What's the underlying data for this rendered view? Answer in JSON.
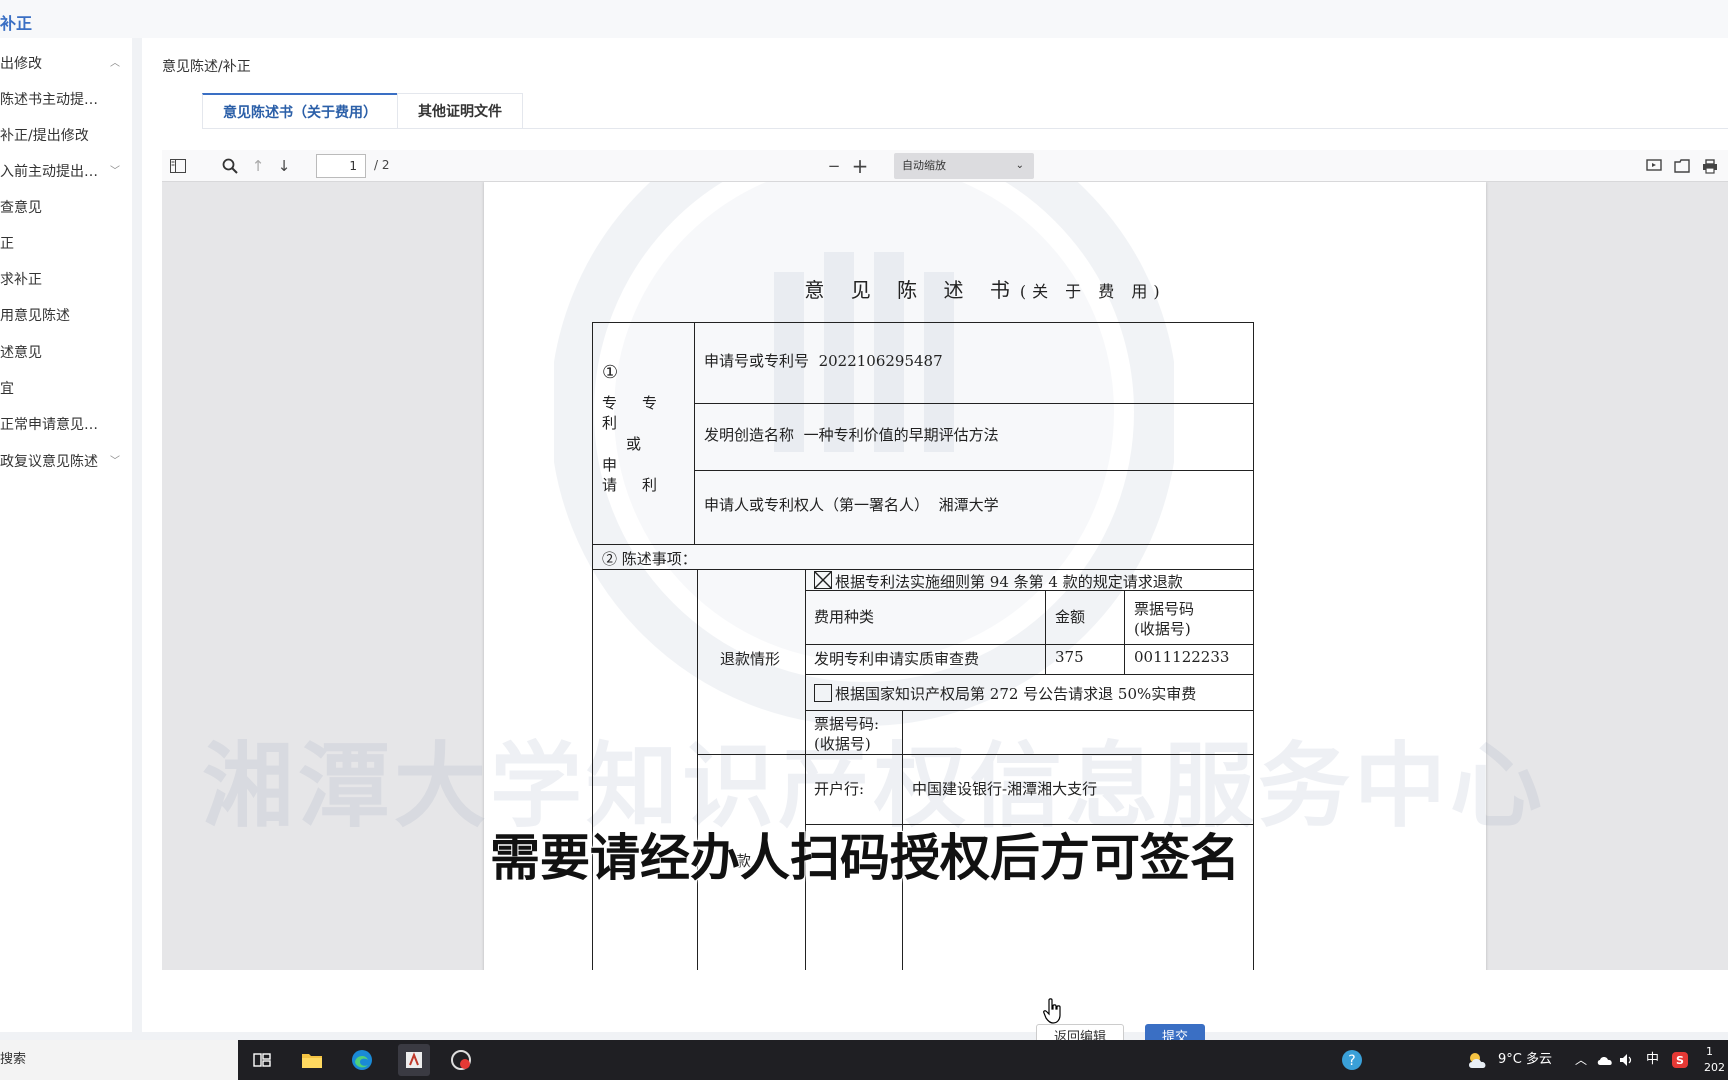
{
  "app": {
    "title": "补正"
  },
  "sidebar": {
    "items": [
      {
        "label": "出修改",
        "chevron": "up"
      },
      {
        "label": "陈述书主动提…"
      },
      {
        "label": "补正/提出修改"
      },
      {
        "label": "入前主动提出…",
        "chevron": "down"
      },
      {
        "label": "查意见"
      },
      {
        "label": "正"
      },
      {
        "label": "求补正"
      },
      {
        "label": "用意见陈述"
      },
      {
        "label": "述意见"
      },
      {
        "label": "宜"
      },
      {
        "label": "正常申请意见…"
      },
      {
        "label": "政复议意见陈述",
        "chevron": "down"
      }
    ]
  },
  "main": {
    "breadcrumb": "意见陈述/补正",
    "tabs": [
      {
        "label": "意见陈述书（关于费用）",
        "active": true
      },
      {
        "label": "其他证明文件",
        "active": false
      }
    ]
  },
  "viewer": {
    "page_current": "1",
    "page_total": "/ 2",
    "zoom_label": "自动缩放"
  },
  "document": {
    "title_main": "意 见 陈 述 书",
    "title_sub": "(关 于 费 用)",
    "section1_num": "①",
    "section1_left": [
      "专",
      "专",
      "利",
      "或",
      "申",
      "请",
      "利"
    ],
    "app_no_label": "申请号或专利号",
    "app_no_value": "2022106295487",
    "invention_label": "发明创造名称",
    "invention_value": "一种专利价值的早期评估方法",
    "applicant_label": "申请人或专利权人（第一署名人）",
    "applicant_value": "湘潭大学",
    "section2": "② 陈述事项：",
    "refund_label": "退款情形",
    "refund_rule_1": "根据专利法实施细则第 94 条第 4 款的规定请求退款",
    "fee_type_header": "费用种类",
    "amount_header": "金额",
    "receipt_header_1": "票据号码",
    "receipt_header_2": "(收据号)",
    "fee_type_value": "发明专利申请实质审查费",
    "amount_value": "375",
    "receipt_value": "0011122233",
    "refund_rule_2": "根据国家知识产权局第 272 号公告请求退 50%实审费",
    "receipt_label_1": "票据号码:",
    "receipt_label_2": "(收据号)",
    "bank_label": "开户行:",
    "bank_value": "中国建设银行-湘潭湘大支行",
    "partial_label": "款"
  },
  "watermark": {
    "text": "湘潭大学知识产权信息服务中心"
  },
  "subtitle": "需要请经办人扫码授权后方可签名",
  "footer": {
    "back_label": "返回编辑",
    "submit_label": "提交"
  },
  "taskbar": {
    "search_label": "搜索",
    "weather": "9°C  多云",
    "ime": "中",
    "clock_top": "1",
    "clock_bottom": "202"
  },
  "colors": {
    "accent": "#3a6fc4",
    "taskbar": "#1f1f23"
  }
}
